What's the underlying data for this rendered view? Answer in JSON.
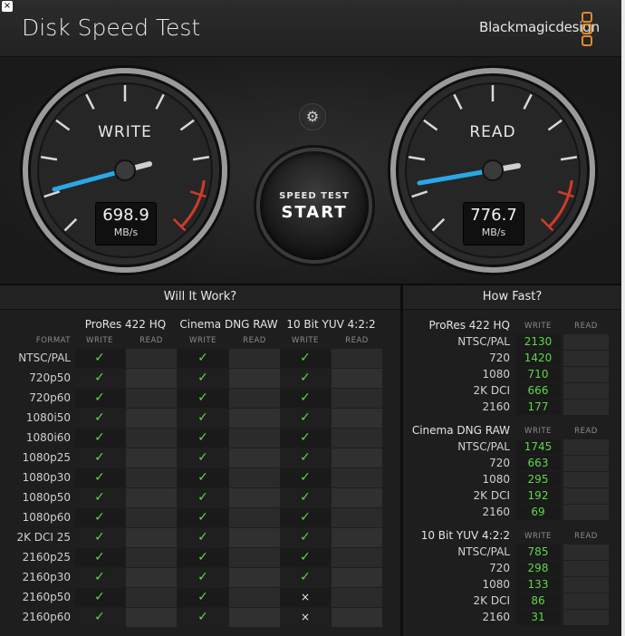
{
  "window": {
    "close_glyph": "×"
  },
  "header": {
    "title": "Disk Speed Test",
    "brand": "Blackmagicdesign"
  },
  "gauges": {
    "write": {
      "label": "WRITE",
      "value": "698.9",
      "unit": "MB/s"
    },
    "read": {
      "label": "READ",
      "value": "776.7",
      "unit": "MB/s"
    }
  },
  "controls": {
    "settings_icon": "gear-icon",
    "start_small": "SPEED TEST",
    "start_big": "START"
  },
  "will_it_work": {
    "title": "Will It Work?",
    "format_label": "FORMAT",
    "write_label": "WRITE",
    "read_label": "READ",
    "columns": [
      "ProRes 422 HQ",
      "Cinema DNG RAW",
      "10 Bit YUV 4:2:2"
    ],
    "rows": [
      {
        "format": "NTSC/PAL",
        "marks": [
          "✓",
          "✓",
          "✓"
        ]
      },
      {
        "format": "720p50",
        "marks": [
          "✓",
          "✓",
          "✓"
        ]
      },
      {
        "format": "720p60",
        "marks": [
          "✓",
          "✓",
          "✓"
        ]
      },
      {
        "format": "1080i50",
        "marks": [
          "✓",
          "✓",
          "✓"
        ]
      },
      {
        "format": "1080i60",
        "marks": [
          "✓",
          "✓",
          "✓"
        ]
      },
      {
        "format": "1080p25",
        "marks": [
          "✓",
          "✓",
          "✓"
        ]
      },
      {
        "format": "1080p30",
        "marks": [
          "✓",
          "✓",
          "✓"
        ]
      },
      {
        "format": "1080p50",
        "marks": [
          "✓",
          "✓",
          "✓"
        ]
      },
      {
        "format": "1080p60",
        "marks": [
          "✓",
          "✓",
          "✓"
        ]
      },
      {
        "format": "2K DCI 25",
        "marks": [
          "✓",
          "✓",
          "✓"
        ]
      },
      {
        "format": "2160p25",
        "marks": [
          "✓",
          "✓",
          "✓"
        ]
      },
      {
        "format": "2160p30",
        "marks": [
          "✓",
          "✓",
          "✓"
        ]
      },
      {
        "format": "2160p50",
        "marks": [
          "✓",
          "✓",
          "×"
        ]
      },
      {
        "format": "2160p60",
        "marks": [
          "✓",
          "✓",
          "×"
        ]
      }
    ]
  },
  "how_fast": {
    "title": "How Fast?",
    "write_label": "WRITE",
    "read_label": "READ",
    "groups": [
      {
        "name": "ProRes 422 HQ",
        "rows": [
          {
            "label": "NTSC/PAL",
            "write": "2130"
          },
          {
            "label": "720",
            "write": "1420"
          },
          {
            "label": "1080",
            "write": "710"
          },
          {
            "label": "2K DCI",
            "write": "666"
          },
          {
            "label": "2160",
            "write": "177"
          }
        ]
      },
      {
        "name": "Cinema DNG RAW",
        "rows": [
          {
            "label": "NTSC/PAL",
            "write": "1745"
          },
          {
            "label": "720",
            "write": "663"
          },
          {
            "label": "1080",
            "write": "295"
          },
          {
            "label": "2K DCI",
            "write": "192"
          },
          {
            "label": "2160",
            "write": "69"
          }
        ]
      },
      {
        "name": "10 Bit YUV 4:2:2",
        "rows": [
          {
            "label": "NTSC/PAL",
            "write": "785"
          },
          {
            "label": "720",
            "write": "298"
          },
          {
            "label": "1080",
            "write": "133"
          },
          {
            "label": "2K DCI",
            "write": "86"
          },
          {
            "label": "2160",
            "write": "31"
          }
        ]
      }
    ]
  },
  "colors": {
    "accent_green": "#5fd64b",
    "needle_blue": "#29a8e8",
    "redline": "#d23a2a",
    "brand_orange": "#e08a2b"
  }
}
